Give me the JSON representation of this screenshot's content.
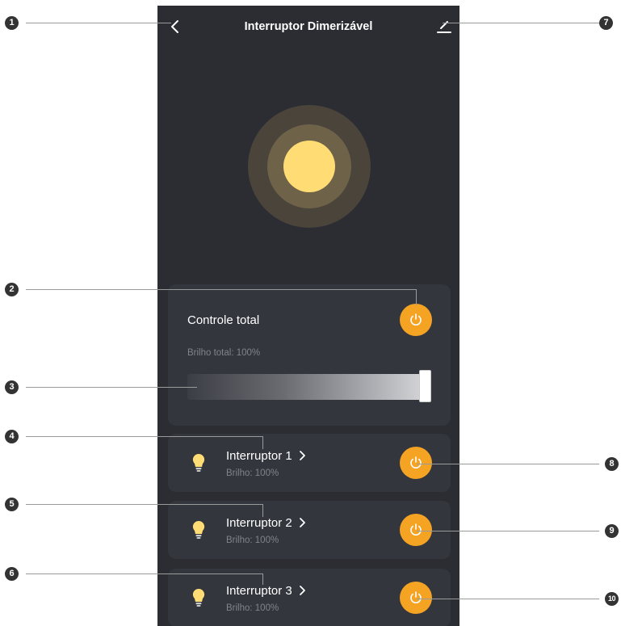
{
  "header": {
    "title": "Interruptor Dimerizável",
    "back_icon": "chevron-left-icon",
    "edit_icon": "pencil-icon"
  },
  "colors": {
    "background": "#2b2d33",
    "card": "#33363d",
    "accent": "#f5a323",
    "light": "#ffdc74"
  },
  "total_control": {
    "title": "Controle total",
    "brightness_label": "Brilho total: 100%",
    "brightness_value": 100,
    "power_on": true
  },
  "switches": [
    {
      "name": "Interruptor 1",
      "brightness": "Brilho: 100%",
      "power_on": true
    },
    {
      "name": "Interruptor 2",
      "brightness": "Brilho: 100%",
      "power_on": true
    },
    {
      "name": "Interruptor 3",
      "brightness": "Brilho: 100%",
      "power_on": true
    }
  ],
  "callouts": [
    "1",
    "2",
    "3",
    "4",
    "5",
    "6",
    "7",
    "8",
    "9",
    "10"
  ]
}
